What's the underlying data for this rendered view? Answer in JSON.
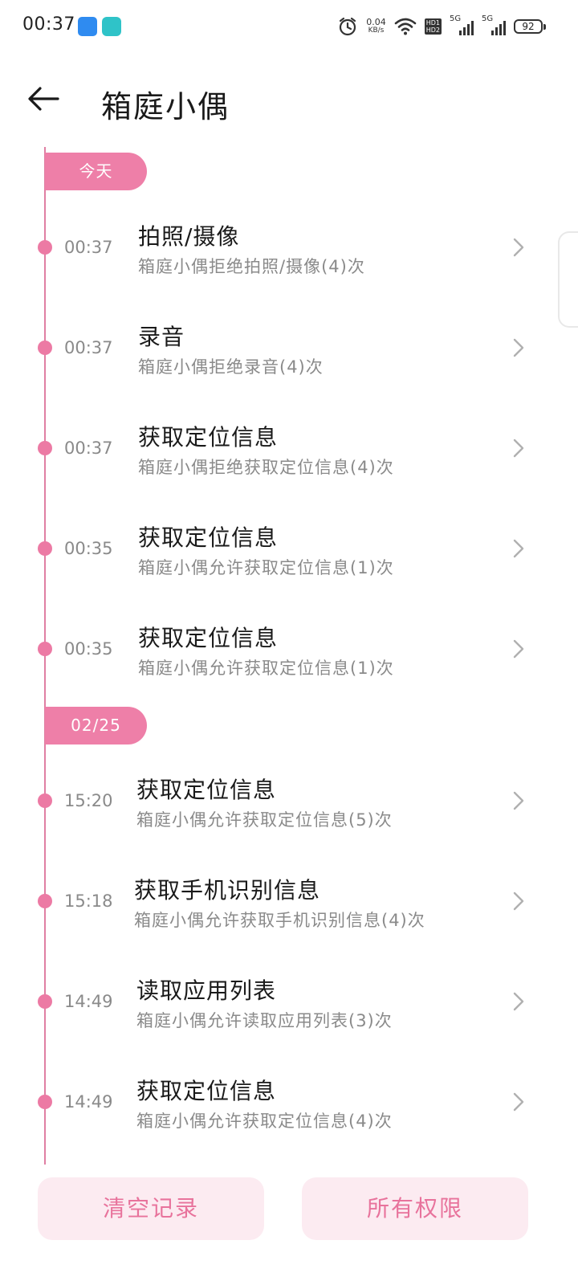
{
  "status_bar": {
    "time": "00:37",
    "net_speed_value": "0.04",
    "net_speed_unit": "KB/s",
    "hd1": "HD1",
    "hd2": "HD2",
    "sim1_label": "5G",
    "sim2_label": "5G",
    "battery": "92"
  },
  "header": {
    "title": "箱庭小偶"
  },
  "sections": [
    {
      "date": "今天",
      "records": [
        {
          "time": "00:37",
          "title": "拍照/摄像",
          "desc": "箱庭小偶拒绝拍照/摄像(4)次"
        },
        {
          "time": "00:37",
          "title": "录音",
          "desc": "箱庭小偶拒绝录音(4)次"
        },
        {
          "time": "00:37",
          "title": "获取定位信息",
          "desc": "箱庭小偶拒绝获取定位信息(4)次"
        },
        {
          "time": "00:35",
          "title": "获取定位信息",
          "desc": "箱庭小偶允许获取定位信息(1)次"
        },
        {
          "time": "00:35",
          "title": "获取定位信息",
          "desc": "箱庭小偶允许获取定位信息(1)次"
        }
      ]
    },
    {
      "date": "02/25",
      "records": [
        {
          "time": "15:20",
          "title": "获取定位信息",
          "desc": "箱庭小偶允许获取定位信息(5)次"
        },
        {
          "time": "15:18",
          "title": "获取手机识别信息",
          "desc": "箱庭小偶允许获取手机识别信息(4)次"
        },
        {
          "time": "14:49",
          "title": "读取应用列表",
          "desc": "箱庭小偶允许读取应用列表(3)次"
        },
        {
          "time": "14:49",
          "title": "获取定位信息",
          "desc": "箱庭小偶允许获取定位信息(4)次"
        }
      ]
    }
  ],
  "buttons": {
    "clear": "清空记录",
    "all_permissions": "所有权限"
  },
  "colors": {
    "accent": "#ee7fa8",
    "button_bg": "#fcebf1",
    "button_text": "#e8739c"
  }
}
